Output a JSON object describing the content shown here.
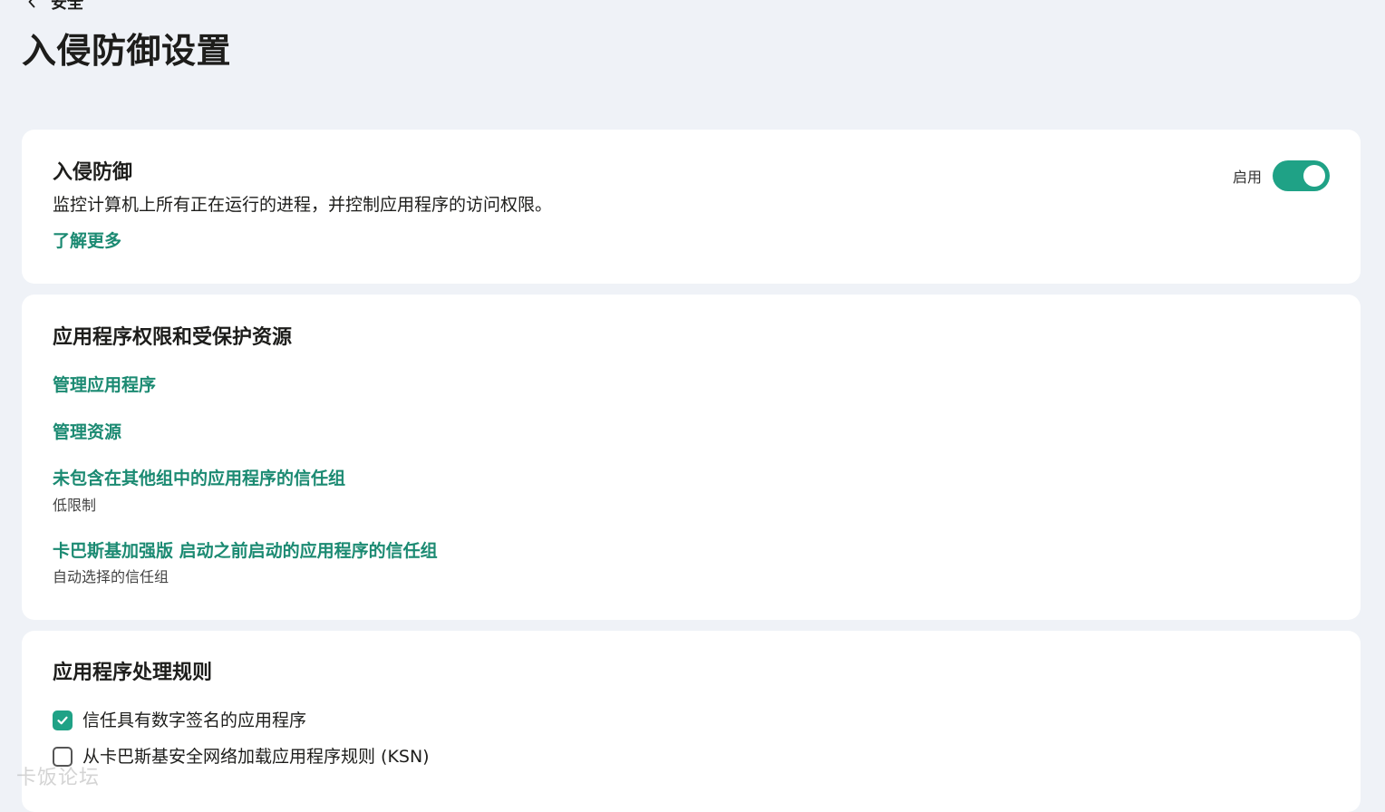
{
  "breadcrumb": {
    "back_label": "安全"
  },
  "page": {
    "title": "入侵防御设置"
  },
  "intrusion_prevention": {
    "title": "入侵防御",
    "description": "监控计算机上所有正在运行的进程，并控制应用程序的访问权限。",
    "learn_more": "了解更多",
    "toggle_label": "启用",
    "toggle_on": true
  },
  "permissions": {
    "title": "应用程序权限和受保护资源",
    "manage_apps": "管理应用程序",
    "manage_resources": "管理资源",
    "trust_group_other": {
      "label": "未包含在其他组中的应用程序的信任组",
      "value": "低限制"
    },
    "trust_group_before_start": {
      "label": "卡巴斯基加强版 启动之前启动的应用程序的信任组",
      "value": "自动选择的信任组"
    }
  },
  "rules": {
    "title": "应用程序处理规则",
    "options": [
      {
        "label": "信任具有数字签名的应用程序",
        "checked": true
      },
      {
        "label": "从卡巴斯基安全网络加载应用程序规则 (KSN)",
        "checked": false
      }
    ]
  },
  "colors": {
    "accent": "#1fa286",
    "link": "#1b8a72",
    "background": "#eff2f7",
    "card": "#ffffff"
  },
  "icons": {
    "back": "chevron-left-icon",
    "check": "checkmark-icon"
  },
  "watermark": "卡饭论坛"
}
